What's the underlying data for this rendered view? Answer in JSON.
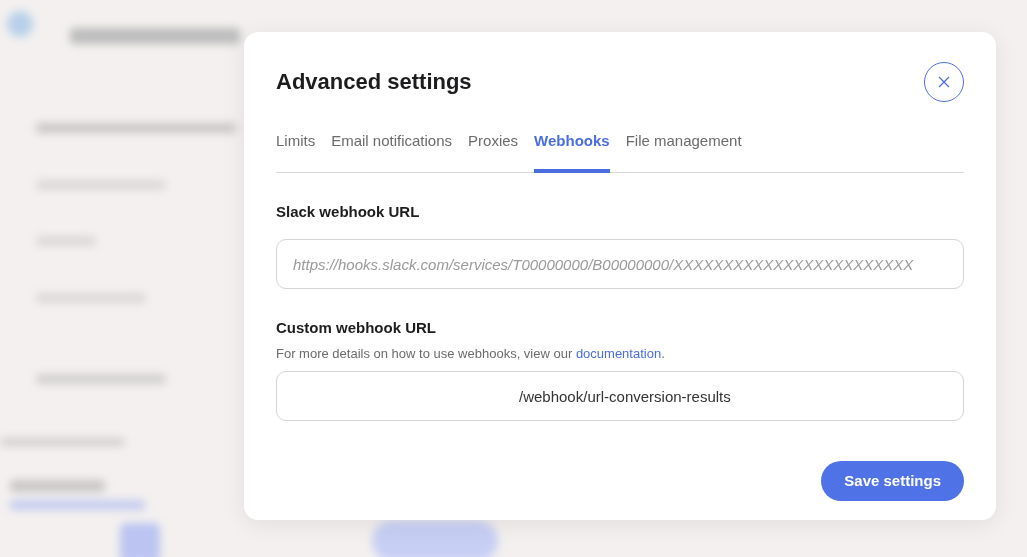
{
  "dialog": {
    "title": "Advanced settings",
    "tabs": [
      {
        "label": "Limits",
        "selected": false
      },
      {
        "label": "Email notifications",
        "selected": false
      },
      {
        "label": "Proxies",
        "selected": false
      },
      {
        "label": "Webhooks",
        "selected": true
      },
      {
        "label": "File management",
        "selected": false
      }
    ],
    "slack_webhook": {
      "label": "Slack webhook URL",
      "placeholder": "https://hooks.slack.com/services/T00000000/B00000000/XXXXXXXXXXXXXXXXXXXXXXXX"
    },
    "custom_webhook": {
      "label": "Custom webhook URL",
      "help_text": "For more details on how to use webhooks, view our ",
      "help_link": "documentation",
      "help_end": ".",
      "value": "/webhook/url-conversion-results"
    },
    "save_button": "Save settings"
  }
}
